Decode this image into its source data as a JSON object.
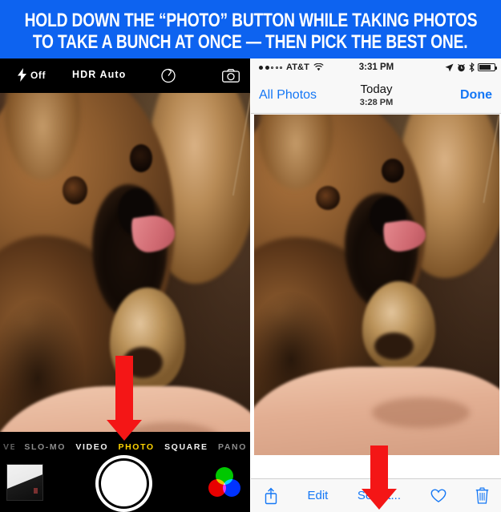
{
  "banner": {
    "line1": "HOLD DOWN THE “PHOTO” BUTTON WHILE TAKING PHOTOS",
    "line2": "TO TAKE A BUNCH AT ONCE — THEN PICK THE BEST ONE.",
    "background_color": "#0d63f0",
    "text_color": "#ffffff"
  },
  "camera": {
    "top": {
      "flash_label": "Off",
      "flash_icon": "lightning-bolt-icon",
      "hdr_label": "HDR Auto",
      "timer_icon": "timer-icon",
      "flip_icon": "camera-flip-icon"
    },
    "modes": [
      {
        "label": "VE",
        "state": "clipped"
      },
      {
        "label": "SLO-MO",
        "state": "dim"
      },
      {
        "label": "VIDEO",
        "state": "bright"
      },
      {
        "label": "PHOTO",
        "state": "active"
      },
      {
        "label": "SQUARE",
        "state": "bright"
      },
      {
        "label": "PANO",
        "state": "dim"
      }
    ],
    "active_mode_color": "#ffd400",
    "bottom": {
      "thumbnail_name": "last-photo-thumbnail",
      "shutter_name": "shutter-button",
      "filters_name": "filters-icon"
    },
    "viewfinder_alt": "Pomeranian dog resting on a person's arm, tongue out"
  },
  "photos": {
    "status": {
      "signal": "●●○○○",
      "carrier": "AT&T",
      "wifi_icon": "wifi-icon",
      "time": "3:31 PM",
      "location_icon": "location-arrow-icon",
      "alarm_icon": "alarm-clock-icon",
      "bluetooth_icon": "bluetooth-icon",
      "battery_icon": "battery-icon"
    },
    "nav": {
      "back_label": "All Photos",
      "title": "Today",
      "subtitle": "3:28 PM",
      "done_label": "Done"
    },
    "toolbar": {
      "share_icon": "share-icon",
      "edit_label": "Edit",
      "select_label": "Select...",
      "favorite_icon": "heart-icon",
      "trash_icon": "trash-icon"
    },
    "photo_alt": "Pomeranian dog resting on a person's arm, tongue out"
  },
  "annotations": {
    "arrow_color": "#f41616",
    "left_arrow_target": "shutter-button",
    "right_arrow_target": "select-button"
  }
}
